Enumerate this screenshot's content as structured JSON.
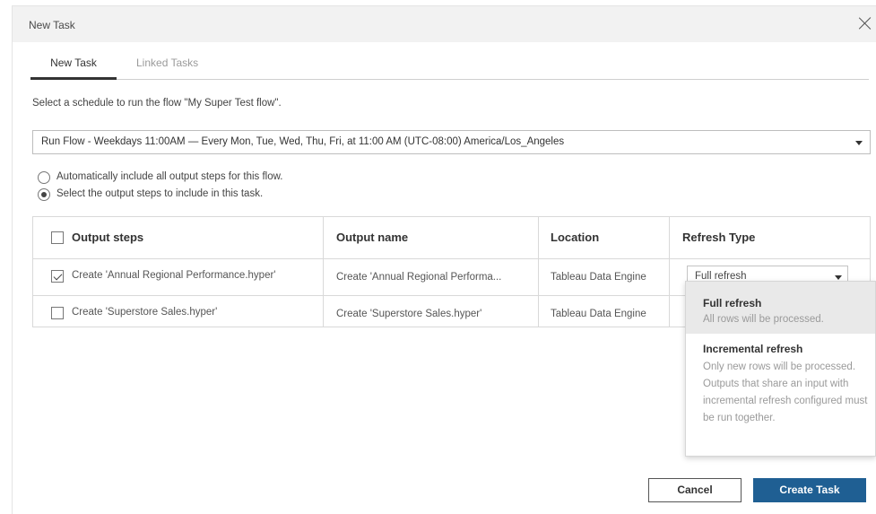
{
  "dialog": {
    "title": "New Task"
  },
  "tabs": [
    {
      "label": "New Task",
      "active": true
    },
    {
      "label": "Linked Tasks",
      "active": false
    }
  ],
  "instruction": "Select a schedule to run the flow \"My Super Test flow\".",
  "schedule_select": {
    "value": "Run Flow - Weekdays 11:00AM — Every Mon, Tue, Wed, Thu, Fri, at 11:00 AM (UTC-08:00) America/Los_Angeles"
  },
  "radio_options": [
    {
      "label": "Automatically include all output steps for this flow.",
      "checked": false
    },
    {
      "label": "Select the output steps to include in this task.",
      "checked": true
    }
  ],
  "table": {
    "headers": [
      "Output steps",
      "Output name",
      "Location",
      "Refresh Type"
    ],
    "header_checkbox_checked": false,
    "rows": [
      {
        "checked": true,
        "output_step": "Create 'Annual Regional Performance.hyper'",
        "output_name": "Create 'Annual Regional Performa...",
        "location": "Tableau Data Engine",
        "refresh_type": "Full refresh"
      },
      {
        "checked": false,
        "output_step": "Create 'Superstore Sales.hyper'",
        "output_name": "Create 'Superstore Sales.hyper'",
        "location": "Tableau Data Engine",
        "refresh_type": ""
      }
    ]
  },
  "refresh_menu": {
    "items": [
      {
        "title": "Full refresh",
        "description": "All rows will be processed.",
        "selected": true
      },
      {
        "title": "Incremental refresh",
        "description": "Only new rows will be processed. Outputs that share an input with incremental refresh configured must be run together.",
        "selected": false
      }
    ]
  },
  "buttons": {
    "cancel": "Cancel",
    "create": "Create Task"
  },
  "colors": {
    "primary": "#1f5f93",
    "menu_highlight": "#e9e9e9",
    "titlebar": "#f2f2f2"
  }
}
